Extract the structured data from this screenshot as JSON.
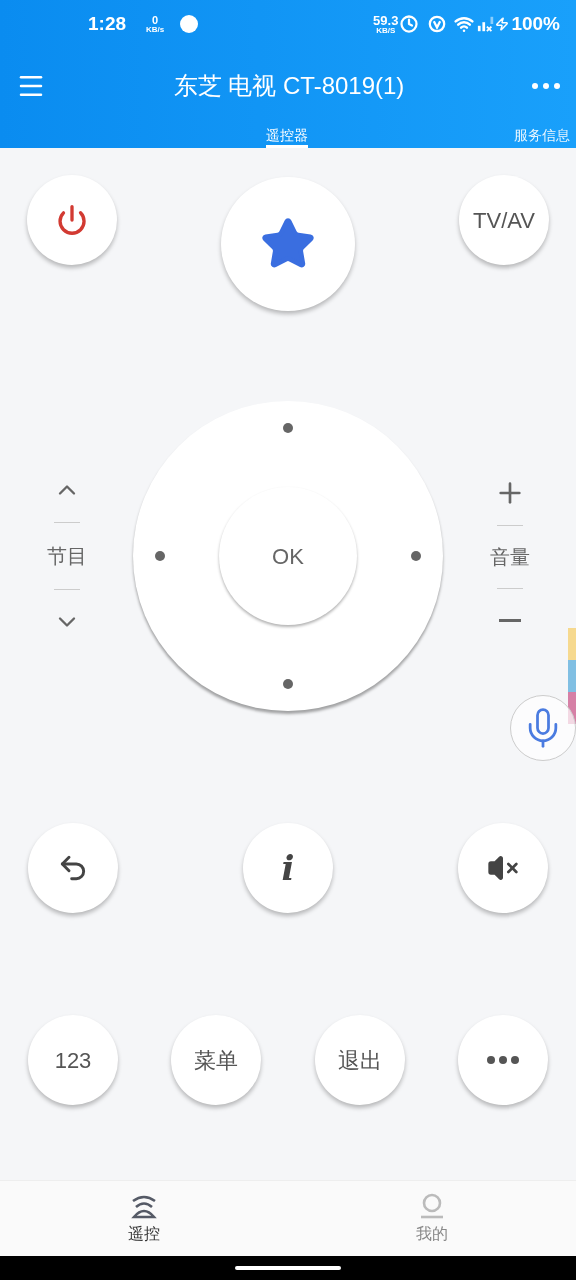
{
  "status_bar": {
    "time": "1:28",
    "left_speed": "0",
    "left_speed_unit": "KB/s",
    "right_speed": "59.3",
    "right_speed_unit": "KB/S",
    "battery": "100%"
  },
  "header": {
    "title": "东芝 电视 CT-8019(1)",
    "tabs": [
      {
        "label": "遥控器",
        "selected": true
      },
      {
        "label": "服务信息",
        "selected": false
      }
    ]
  },
  "top_buttons": [
    {
      "kind": "power"
    },
    {
      "kind": "favorite"
    },
    {
      "kind": "text",
      "label": "TV/AV"
    }
  ],
  "channel": {
    "label": "节目"
  },
  "dpad": {
    "ok": "OK"
  },
  "volume": {
    "label": "音量"
  },
  "color_strip": [
    {
      "color": "#f6d98f"
    },
    {
      "color": "#80bfe3"
    },
    {
      "color": "#d680a6"
    }
  ],
  "middle_buttons": [
    {
      "kind": "back"
    },
    {
      "kind": "info",
      "label": "i"
    },
    {
      "kind": "mute"
    }
  ],
  "bottom_buttons": [
    {
      "kind": "text",
      "label": "123"
    },
    {
      "kind": "text",
      "label": "菜单"
    },
    {
      "kind": "text",
      "label": "退出"
    },
    {
      "kind": "more"
    }
  ],
  "nav": [
    {
      "kind": "remote",
      "label": "遥控",
      "selected": true
    },
    {
      "kind": "profile",
      "label": "我的",
      "selected": false
    }
  ]
}
